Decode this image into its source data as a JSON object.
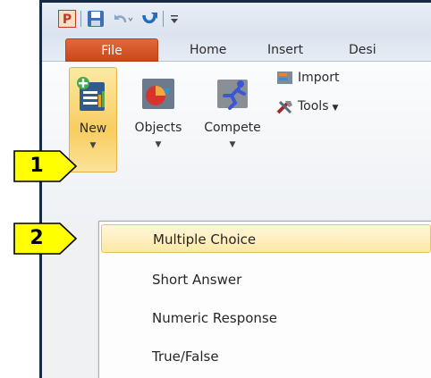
{
  "tabs": [
    "File",
    "Home",
    "Insert",
    "Desi"
  ],
  "ribbon": {
    "new_label": "New",
    "objects_label": "Objects",
    "compete_label": "Compete",
    "import_label": "Import",
    "tools_label": "Tools"
  },
  "dropdown": {
    "items": [
      "Multiple Choice",
      "Short Answer",
      "Numeric Response",
      "True/False"
    ]
  },
  "callouts": [
    "1",
    "2"
  ],
  "colors": {
    "file_tab": "#c9461c",
    "highlight": "#fde8a6",
    "callout": "#ffff00",
    "frame": "#1b2a44"
  }
}
